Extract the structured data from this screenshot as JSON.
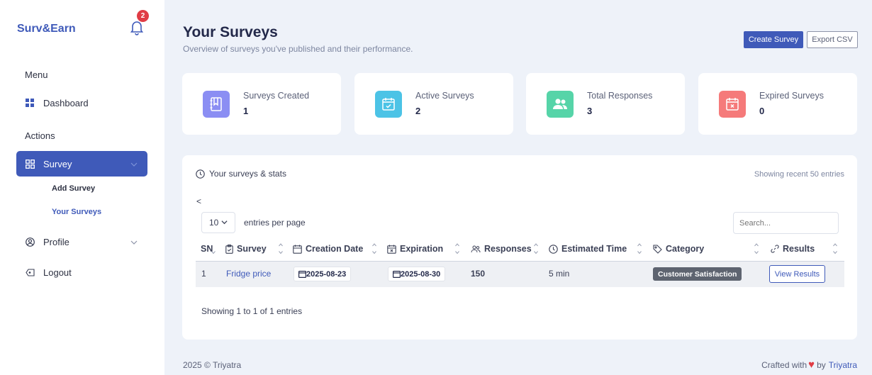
{
  "brand": "Surv&Earn",
  "notifications": {
    "count": "2"
  },
  "sidebar": {
    "menu_heading": "Menu",
    "actions_heading": "Actions",
    "items": [
      {
        "label": "Dashboard",
        "icon": "grid-icon"
      },
      {
        "label": "Survey",
        "icon": "apps-icon",
        "active": true,
        "children": [
          {
            "label": "Add Survey"
          },
          {
            "label": "Your Surveys",
            "current": true
          }
        ]
      },
      {
        "label": "Profile",
        "icon": "user-circle-icon"
      },
      {
        "label": "Logout",
        "icon": "logout-icon"
      }
    ]
  },
  "header": {
    "title": "Your Surveys",
    "subtitle": "Overview of surveys you've published and their performance.",
    "create_label": "Create Survey",
    "export_label": "Export CSV"
  },
  "stats": [
    {
      "label": "Surveys Created",
      "value": "1",
      "icon": "notebook-icon",
      "color": "#8b8ef3"
    },
    {
      "label": "Active Surveys",
      "value": "2",
      "icon": "calendar-check-icon",
      "color": "#4cc3e6"
    },
    {
      "label": "Total Responses",
      "value": "3",
      "icon": "users-icon",
      "color": "#56d4a8"
    },
    {
      "label": "Expired Surveys",
      "value": "0",
      "icon": "calendar-x-icon",
      "color": "#f57a7a"
    }
  ],
  "table": {
    "heading": "Your surveys & stats",
    "note": "Showing recent 50 entries",
    "back": "<",
    "per_page_value": "10",
    "per_page_label": "entries per page",
    "search_placeholder": "Search...",
    "columns": [
      "SN",
      "Survey",
      "Creation Date",
      "Expiration",
      "Responses",
      "Estimated Time",
      "Category",
      "Results"
    ],
    "rows": [
      {
        "sn": "1",
        "survey": "Fridge price",
        "created": "2025-08-23",
        "expires": "2025-08-30",
        "responses": "150",
        "time": "5 min",
        "category": "Customer Satisfaction",
        "action": "View Results"
      }
    ],
    "info": "Showing 1 to 1 of 1 entries"
  },
  "footer": {
    "copyright": "2025 © Triyatra",
    "crafted": "Crafted with",
    "by": "by",
    "author": "Triyatra"
  }
}
